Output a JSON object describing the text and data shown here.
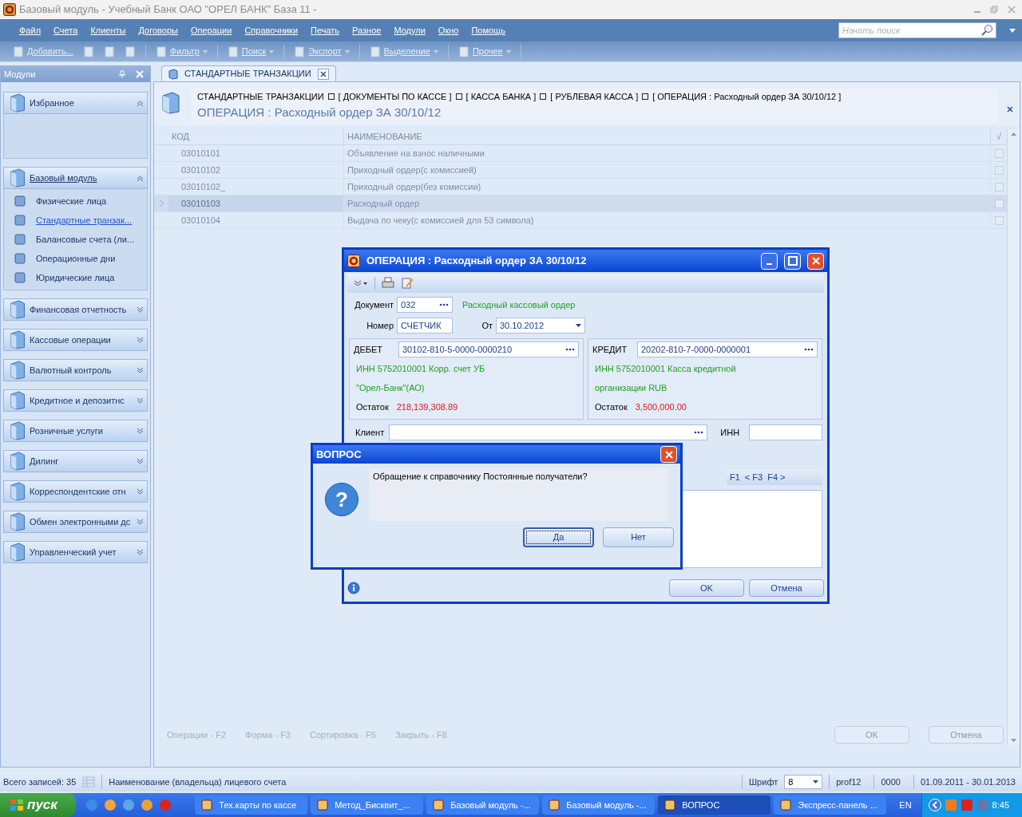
{
  "window": {
    "title": "Базовый модуль - Учебный Банк ОАО \"ОРЕЛ БАНК\" База 11 -"
  },
  "menu": [
    "Файл",
    "Счета",
    "Клиенты",
    "Договоры",
    "Операции",
    "Справочники",
    "Печать",
    "Разное",
    "Модули",
    "Окно",
    "Помощь"
  ],
  "search": {
    "placeholder": "Начать поиск"
  },
  "toolbar": [
    {
      "label": "Добавить...",
      "dropdown": false
    },
    {
      "label": "Фильтр",
      "dropdown": true
    },
    {
      "label": "Поиск",
      "dropdown": true
    },
    {
      "label": "Экспорт",
      "dropdown": true
    },
    {
      "label": "Выделение",
      "dropdown": true
    },
    {
      "label": "Прочее",
      "dropdown": true
    }
  ],
  "sidebar": {
    "title": "Модули",
    "groups": [
      {
        "label": "Избранное",
        "expanded": true
      },
      {
        "label": "Базовый модуль",
        "expanded": true,
        "items": [
          {
            "label": "Физические лица",
            "selected": false
          },
          {
            "label": "Стандартные транзак...",
            "selected": true
          },
          {
            "label": "Балансовые счета (ли...",
            "selected": false
          },
          {
            "label": "Операционные дни",
            "selected": false
          },
          {
            "label": "Юридические лица",
            "selected": false
          }
        ]
      },
      {
        "label": "Финансовая отчетность",
        "expanded": false
      },
      {
        "label": "Кассовые операции",
        "expanded": false
      },
      {
        "label": "Валютный контроль",
        "expanded": false
      },
      {
        "label": "Кредитное и депозитнс",
        "expanded": false
      },
      {
        "label": "Розничные услуги",
        "expanded": false
      },
      {
        "label": "Дилинг",
        "expanded": false
      },
      {
        "label": "Корреспондентские отн",
        "expanded": false
      },
      {
        "label": "Обмен электронными дс",
        "expanded": false
      },
      {
        "label": "Управленческий учет",
        "expanded": false
      }
    ]
  },
  "tab": {
    "label": "СТАНДАРТНЫЕ ТРАНЗАКЦИИ"
  },
  "breadcrumbs": [
    "СТАНДАРТНЫЕ ТРАНЗАКЦИИ",
    "[ ДОКУМЕНТЫ ПО КАССЕ ]",
    "[ КАССА БАНКА ]",
    "[ РУБЛЕВАЯ КАССА ]",
    "[ ОПЕРАЦИЯ : Расходный ордер ЗА 30/10/12 ]"
  ],
  "heading": "ОПЕРАЦИЯ : Расходный ордер ЗА 30/10/12",
  "table": {
    "columns": [
      "КОД",
      "НАИМЕНОВАНИЕ",
      "√"
    ],
    "rows": [
      {
        "code": "03010101",
        "name": "Объявление на взнос наличными",
        "selected": false,
        "checked": false
      },
      {
        "code": "03010102",
        "name": "Приходный ордер(с комиссией)",
        "selected": false,
        "checked": false
      },
      {
        "code": "03010102_",
        "name": "Приходный ордер(без комиссии)",
        "selected": false,
        "checked": false
      },
      {
        "code": "03010103",
        "name": "Расходный ордер",
        "selected": true,
        "checked": false
      },
      {
        "code": "03010104",
        "name": "Выдача по чеку(с комиссией для 53 символа)",
        "selected": false,
        "checked": false
      }
    ]
  },
  "actions": [
    "Операции - F2",
    "Форма - F3",
    "Сортировка - F5",
    "Закрыть - F8"
  ],
  "buttons": [
    {
      "label": "OK",
      "disabled": true
    },
    {
      "label": "Отмена",
      "disabled": true
    }
  ],
  "status_bar": {
    "records": "Всего записей: 35",
    "hint": "Наименование (владельца) лицевого счета",
    "font_label": "Шрифт",
    "font_size": "8",
    "user": "prof12",
    "code": "0000",
    "period": "01.09.2011 - 30.01.2013"
  },
  "operation_dialog": {
    "title": "ОПЕРАЦИЯ : Расходный ордер ЗА 30/10/12",
    "document_label": "Документ",
    "document": "032",
    "document_name": "Расходный кассовый ордер",
    "number_label": "Номер",
    "number": "СЧЕТЧИК",
    "date_label": "От",
    "date": "30.10.2012",
    "debit": {
      "label": "ДЕБЕТ",
      "account": "30102-810-5-0000-0000210",
      "info_1": "ИНН 5752010001 Корр. счет УБ",
      "info_2": "\"Орел-Банк\"(АО)",
      "balance_label": "Остаток",
      "balance": "218,139,308.89"
    },
    "credit": {
      "label": "КРЕДИТ",
      "account": "20202-810-7-0000-0000001",
      "info_1": "ИНН 5752010001 Касса кредитной",
      "info_2": "организации RUB",
      "balance_label": "Остаток",
      "balance": "3,500,000.00"
    },
    "client_label": "Клиент",
    "inn_label": "ИНН",
    "keys": [
      "F1",
      "< F3",
      "F4 >"
    ],
    "buttons": [
      "OK",
      "Отмена"
    ]
  },
  "question_dialog": {
    "title": "ВОПРОС",
    "icon": "?",
    "message": "Обращение к справочнику Постоянные получатели?",
    "buttons": [
      {
        "label": "Да",
        "focused": true
      },
      {
        "label": "Нет",
        "focused": false
      }
    ]
  },
  "taskbar": {
    "start": "пуск",
    "tasks": [
      {
        "label": "Тех.карты по кассе",
        "selected": false
      },
      {
        "label": "Метод_Бисквит_...",
        "selected": false
      },
      {
        "label": "Базовый модуль -...",
        "selected": false
      },
      {
        "label": "Базовый модуль -...",
        "selected": false
      },
      {
        "label": "ВОПРОС",
        "selected": true
      },
      {
        "label": "Экспресс-панель ...",
        "selected": false
      }
    ],
    "lang": "EN",
    "clock": "8:45"
  }
}
